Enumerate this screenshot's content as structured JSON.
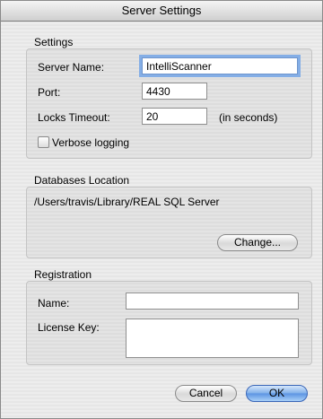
{
  "window": {
    "title": "Server Settings"
  },
  "settings": {
    "group_title": "Settings",
    "server_name_label": "Server Name:",
    "server_name_value": "IntelliScanner",
    "port_label": "Port:",
    "port_value": "4430",
    "locks_timeout_label": "Locks Timeout:",
    "locks_timeout_value": "20",
    "locks_timeout_unit": "(in seconds)",
    "verbose_logging_label": "Verbose logging",
    "verbose_logging_checked": false
  },
  "databases": {
    "group_title": "Databases Location",
    "path": "/Users/travis/Library/REAL SQL Server",
    "change_button": "Change..."
  },
  "registration": {
    "group_title": "Registration",
    "name_label": "Name:",
    "name_value": "",
    "license_key_label": "License Key:",
    "license_key_value": ""
  },
  "footer": {
    "cancel_button": "Cancel",
    "ok_button": "OK"
  }
}
